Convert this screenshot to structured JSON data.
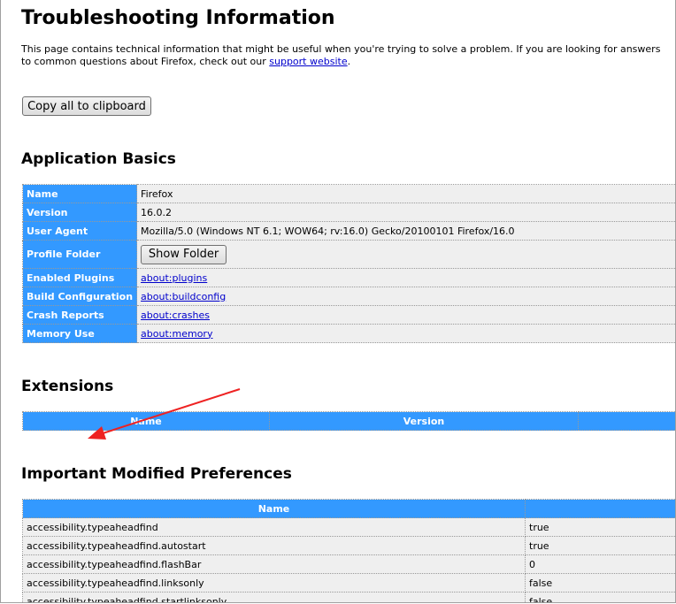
{
  "title": "Troubleshooting Information",
  "intro": {
    "text": "This page contains technical information that might be useful when you're trying to solve a problem. If you are looking for answers to common questions about Firefox, check out our ",
    "link": "support website",
    "end": "."
  },
  "copy_button": "Copy all to clipboard",
  "app_basics": {
    "heading": "Application Basics",
    "rows": [
      {
        "label": "Name",
        "value": "Firefox"
      },
      {
        "label": "Version",
        "value": "16.0.2"
      },
      {
        "label": "User Agent",
        "value": "Mozilla/5.0 (Windows NT 6.1; WOW64; rv:16.0) Gecko/20100101 Firefox/16.0"
      },
      {
        "label": "Profile Folder",
        "button": "Show Folder"
      },
      {
        "label": "Enabled Plugins",
        "link": "about:plugins"
      },
      {
        "label": "Build Configuration",
        "link": "about:buildconfig"
      },
      {
        "label": "Crash Reports",
        "link": "about:crashes"
      },
      {
        "label": "Memory Use",
        "link": "about:memory"
      }
    ]
  },
  "extensions": {
    "heading": "Extensions",
    "columns": [
      "Name",
      "Version"
    ]
  },
  "prefs": {
    "heading": "Important Modified Preferences",
    "columns": [
      "Name"
    ],
    "rows": [
      {
        "name": "accessibility.typeaheadfind",
        "value": "true"
      },
      {
        "name": "accessibility.typeaheadfind.autostart",
        "value": "true"
      },
      {
        "name": "accessibility.typeaheadfind.flashBar",
        "value": "0"
      },
      {
        "name": "accessibility.typeaheadfind.linksonly",
        "value": "false"
      },
      {
        "name": "accessibility.typeaheadfind.startlinksonly",
        "value": "false"
      }
    ]
  },
  "annotation_color": "#ee2222"
}
